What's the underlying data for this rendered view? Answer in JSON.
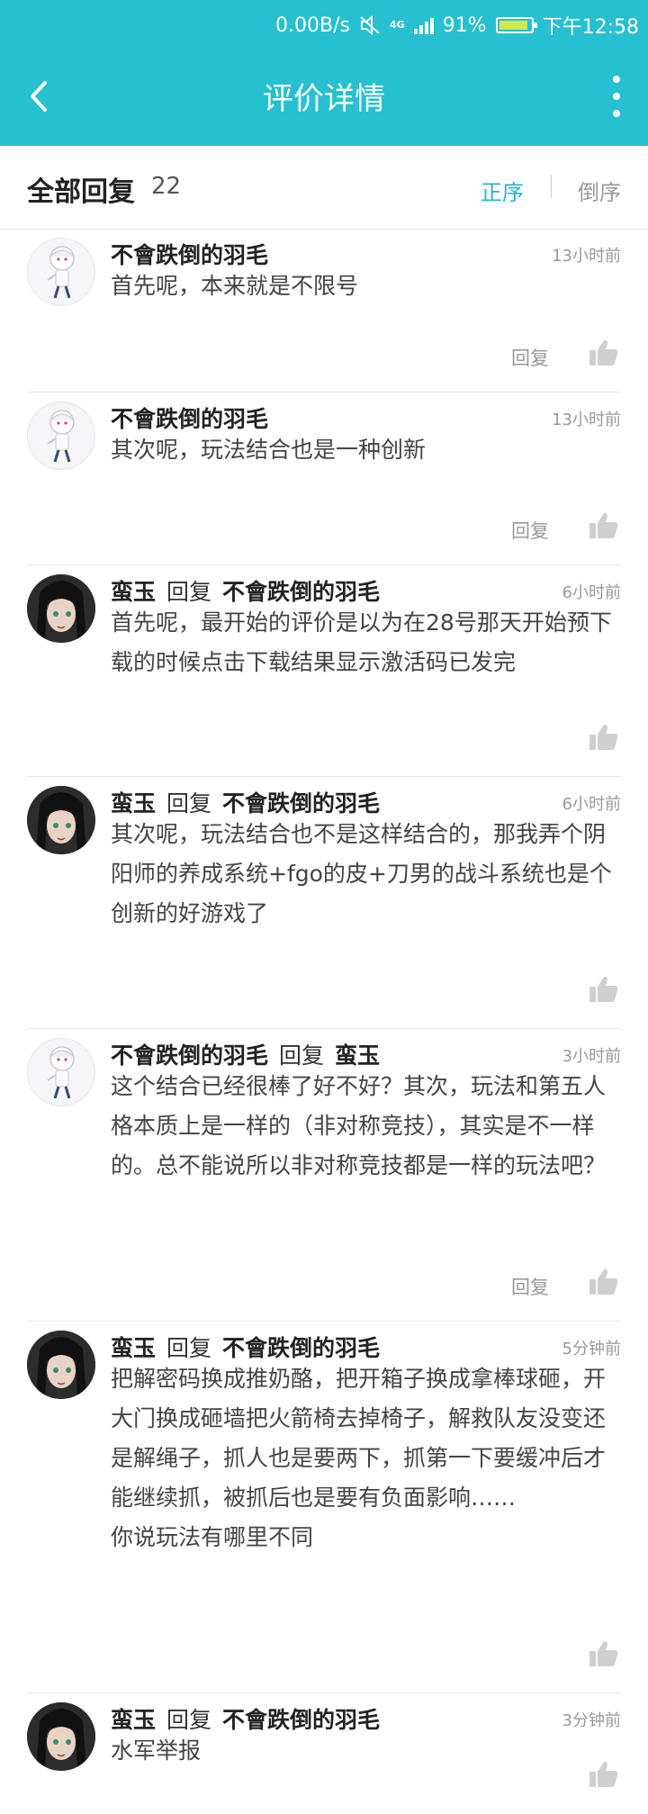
{
  "status_bar": {
    "net_speed": "0.00B/s",
    "network": "4G",
    "battery": "91%",
    "time": "下午12:58"
  },
  "app_bar": {
    "title": "评价详情"
  },
  "header": {
    "label": "全部回复",
    "count": "22",
    "sort_asc": "正序",
    "sort_desc": "倒序"
  },
  "reply_label": "回复",
  "comments": [
    {
      "author": "不會跌倒的羽毛",
      "reply_word": "",
      "reply_to": "",
      "time": "13小时前",
      "text": "首先呢，本来就是不限号",
      "show_reply": true
    },
    {
      "author": "不會跌倒的羽毛",
      "reply_word": "",
      "reply_to": "",
      "time": "13小时前",
      "text": "其次呢，玩法结合也是一种创新",
      "show_reply": true
    },
    {
      "author": "蛮玉",
      "reply_word": "回复",
      "reply_to": "不會跌倒的羽毛",
      "time": "6小时前",
      "text": "首先呢，最开始的评价是以为在28号那天开始预下载的时候点击下载结果显示激活码已发完",
      "show_reply": false
    },
    {
      "author": "蛮玉",
      "reply_word": "回复",
      "reply_to": "不會跌倒的羽毛",
      "time": "6小时前",
      "text": "其次呢，玩法结合也不是这样结合的，那我弄个阴阳师的养成系统+fgo的皮+刀男的战斗系统也是个创新的好游戏了",
      "show_reply": false
    },
    {
      "author": "不會跌倒的羽毛",
      "reply_word": "回复",
      "reply_to": "蛮玉",
      "time": "3小时前",
      "text": "这个结合已经很棒了好不好？其次，玩法和第五人格本质上是一样的（非对称竞技），其实是不一样的。总不能说所以非对称竞技都是一样的玩法吧？",
      "show_reply": true
    },
    {
      "author": "蛮玉",
      "reply_word": "回复",
      "reply_to": "不會跌倒的羽毛",
      "time": "5分钟前",
      "text": "把解密码换成推奶酪，把开箱子换成拿棒球砸，开大门换成砸墙把火箭椅去掉椅子，解救队友没变还是解绳子，抓人也是要两下，抓第一下要缓冲后才能继续抓，被抓后也是要有负面影响……\n你说玩法有哪里不同",
      "show_reply": false
    },
    {
      "author": "蛮玉",
      "reply_word": "回复",
      "reply_to": "不會跌倒的羽毛",
      "time": "3分钟前",
      "text": "水军举报",
      "show_reply": false
    }
  ]
}
